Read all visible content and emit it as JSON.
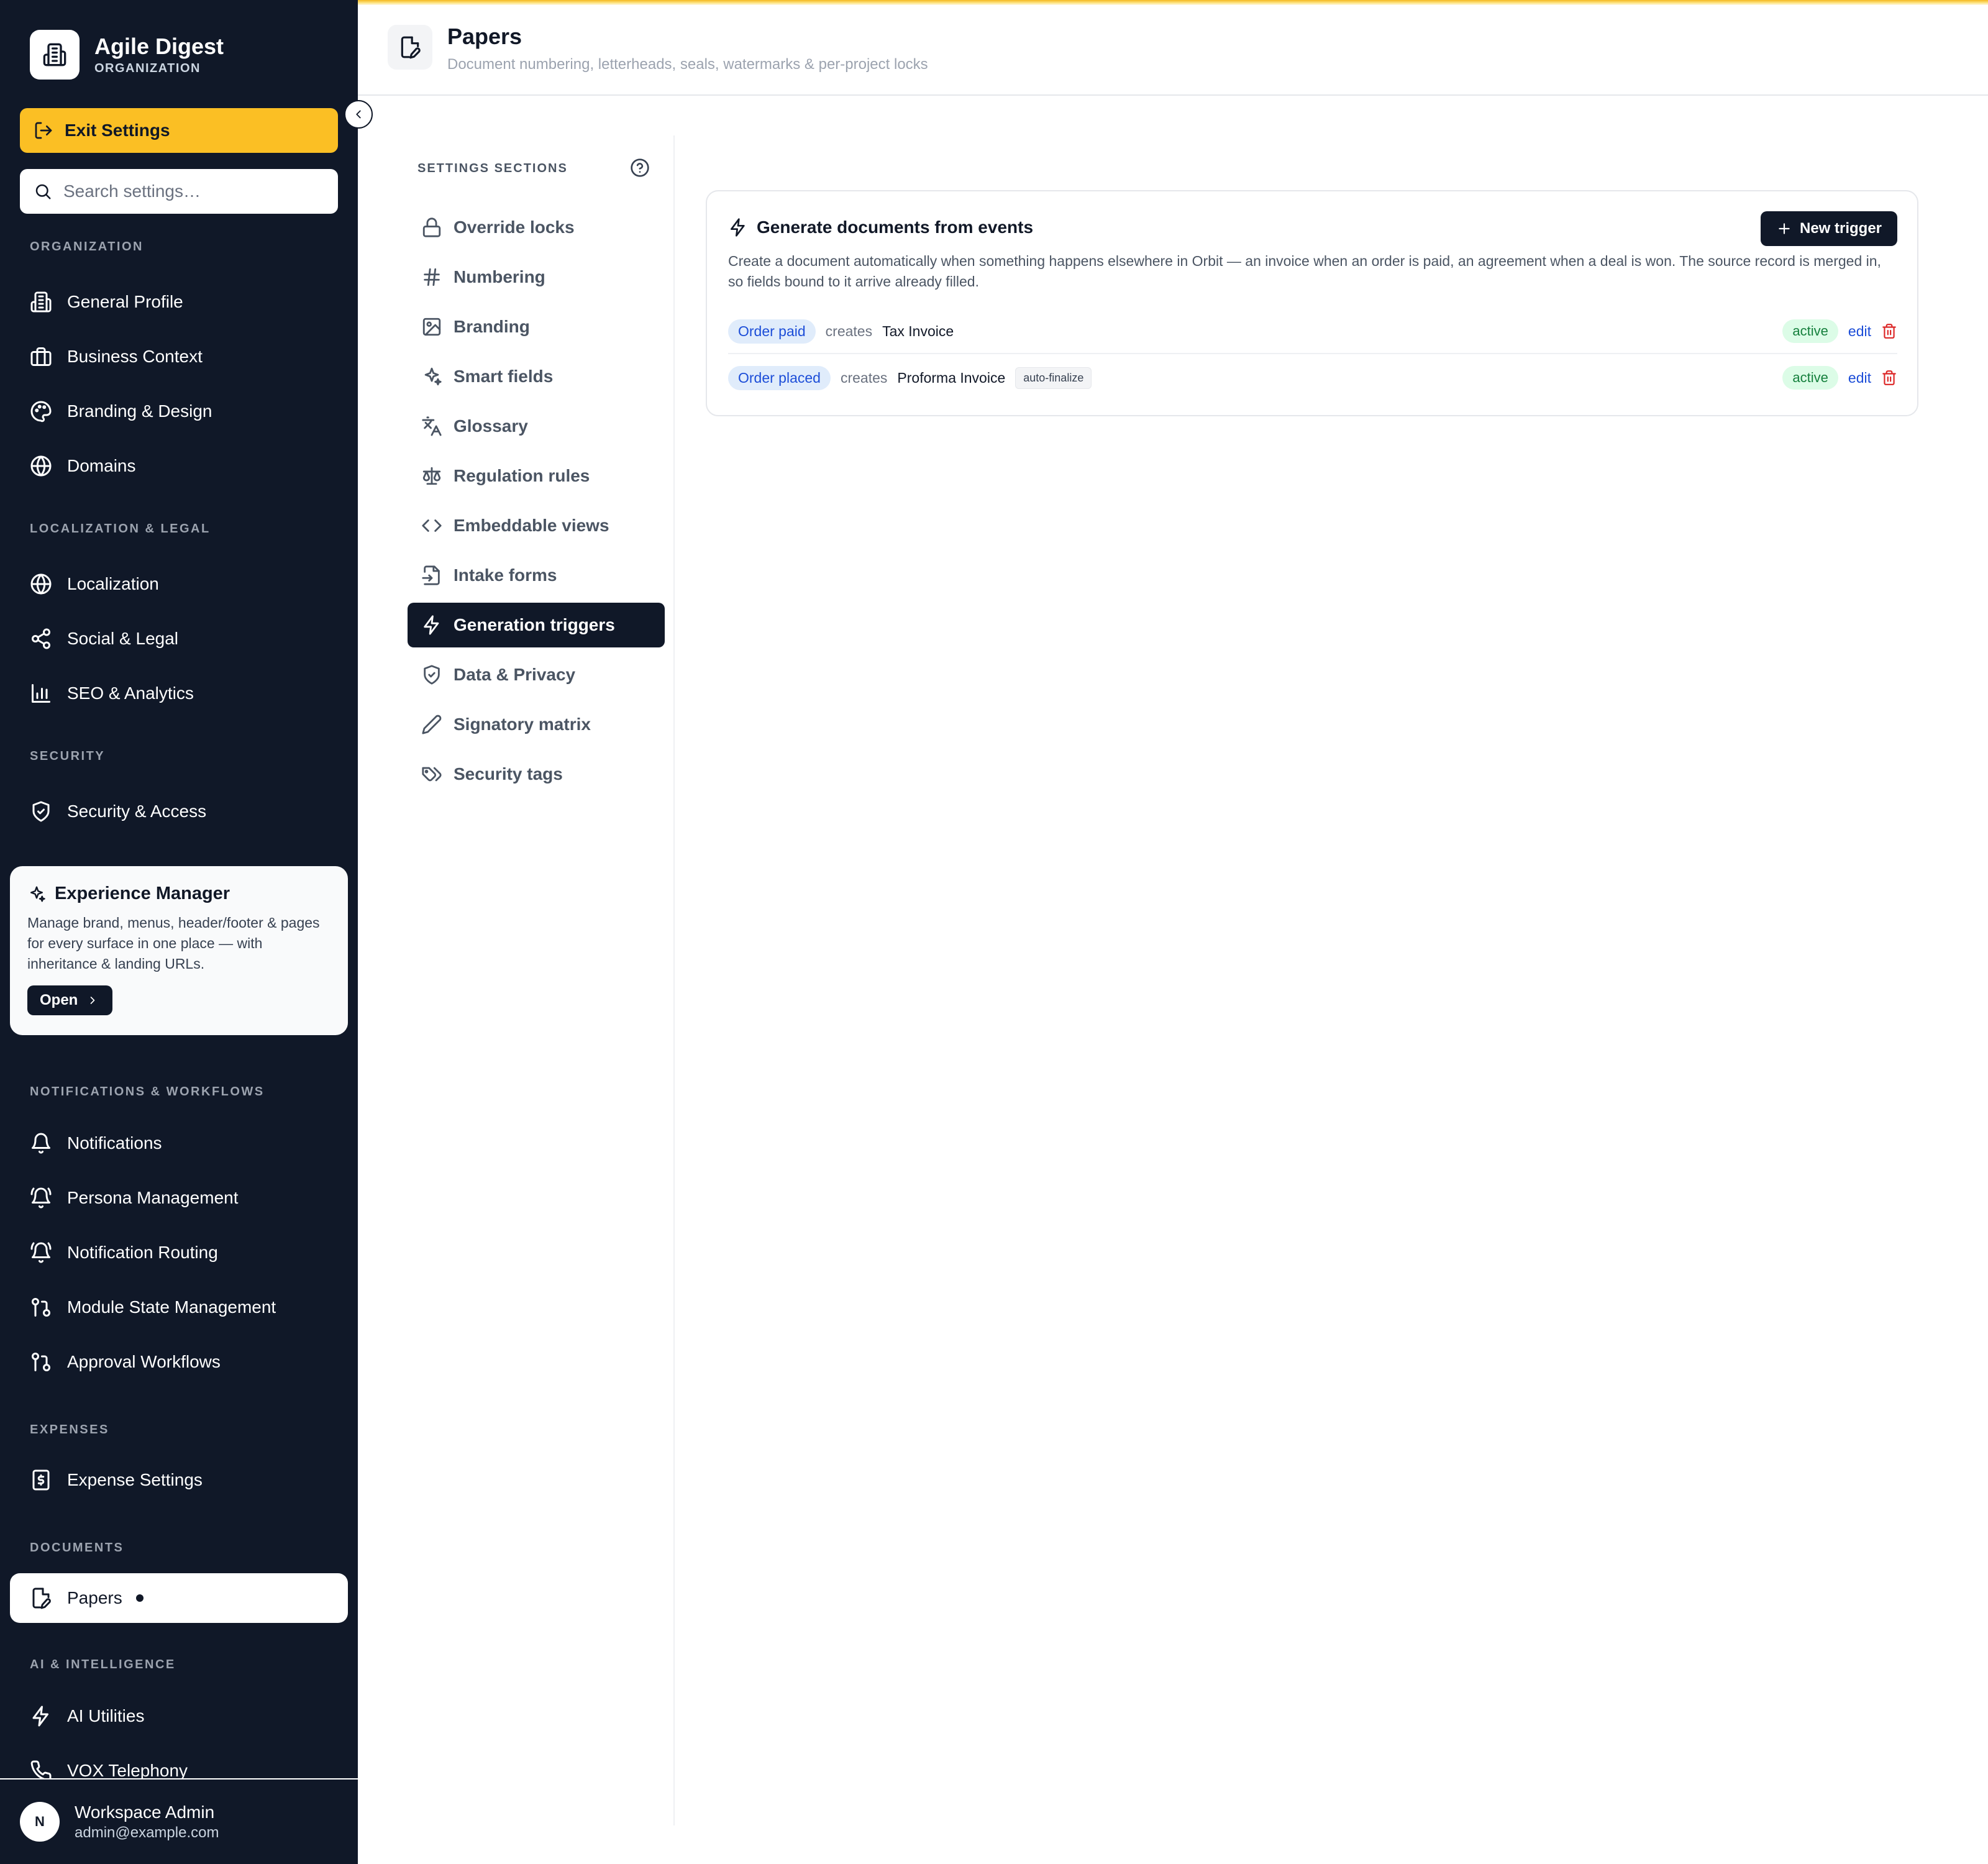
{
  "org": {
    "name": "Agile Digest",
    "type": "ORGANIZATION"
  },
  "sidebar": {
    "exit_label": "Exit Settings",
    "search_placeholder": "Search settings…",
    "sections": {
      "organization": "ORGANIZATION",
      "localization": "LOCALIZATION & LEGAL",
      "security": "SECURITY",
      "notifications": "NOTIFICATIONS & WORKFLOWS",
      "expenses": "EXPENSES",
      "documents": "DOCUMENTS",
      "ai": "AI & INTELLIGENCE"
    },
    "items": {
      "general_profile": "General Profile",
      "business_context": "Business Context",
      "branding_design": "Branding & Design",
      "domains": "Domains",
      "localization": "Localization",
      "social_legal": "Social & Legal",
      "seo_analytics": "SEO & Analytics",
      "security_access": "Security & Access",
      "notifications": "Notifications",
      "persona_management": "Persona Management",
      "notification_routing": "Notification Routing",
      "module_state": "Module State Management",
      "approval_workflows": "Approval Workflows",
      "expense_settings": "Expense Settings",
      "papers": "Papers",
      "ai_utilities": "AI Utilities",
      "vox_telephony": "VOX Telephony"
    },
    "experience_manager": {
      "title": "Experience Manager",
      "description": "Manage brand, menus, header/footer & pages for every surface in one place — with inheritance & landing URLs.",
      "open_label": "Open"
    },
    "user": {
      "initial": "N",
      "name": "Workspace Admin",
      "email": "admin@example.com"
    }
  },
  "header": {
    "title": "Papers",
    "subtitle": "Document numbering, letterheads, seals, watermarks & per-project locks"
  },
  "settings_sections": {
    "label": "SETTINGS SECTIONS",
    "items": [
      "Override locks",
      "Numbering",
      "Branding",
      "Smart fields",
      "Glossary",
      "Regulation rules",
      "Embeddable views",
      "Intake forms",
      "Generation triggers",
      "Data & Privacy",
      "Signatory matrix",
      "Security tags"
    ],
    "active": "Generation triggers"
  },
  "triggers_card": {
    "title": "Generate documents from events",
    "new_label": "New trigger",
    "description": "Create a document automatically when something happens elsewhere in Orbit — an invoice when an order is paid, an agreement when a deal is won. The source record is merged in, so fields bound to it arrive already filled.",
    "rows": [
      {
        "event": "Order paid",
        "verb": "creates",
        "document": "Tax Invoice",
        "flag": "",
        "status": "active",
        "edit_label": "edit"
      },
      {
        "event": "Order placed",
        "verb": "creates",
        "document": "Proforma Invoice",
        "flag": "auto-finalize",
        "status": "active",
        "edit_label": "edit"
      }
    ]
  },
  "colors": {
    "sidebar_bg": "#101828",
    "accent_yellow": "#fbbf24",
    "event_chip": "#e0ecfb",
    "status_active": "#dcfce7",
    "danger": "#dc2626"
  }
}
